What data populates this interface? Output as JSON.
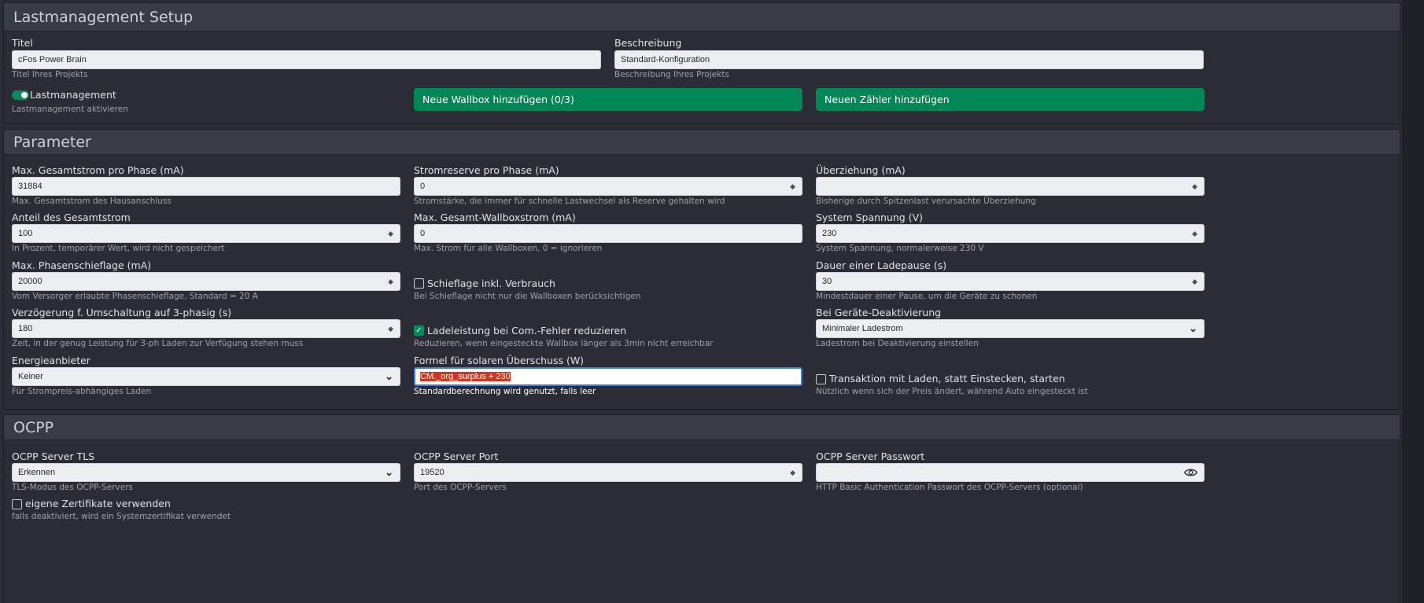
{
  "setup": {
    "title": "Lastmanagement Setup",
    "titel_label": "Titel",
    "titel_value": "cFos Power Brain",
    "titel_help": "Titel Ihres Projekts",
    "beschreibung_label": "Beschreibung",
    "beschreibung_value": "Standard-Konfiguration",
    "beschreibung_help": "Beschreibung Ihres Projekts",
    "lastmanagement_label": "Lastmanagement",
    "lastmanagement_help": "Lastmanagement aktivieren",
    "lastmanagement_enabled": true,
    "add_wallbox_button": "Neue Wallbox hinzufügen (0/3)",
    "add_meter_button": "Neuen Zähler hinzufügen"
  },
  "parameter": {
    "title": "Parameter",
    "fields": {
      "max_gesamtstrom": {
        "label": "Max. Gesamtstrom pro Phase (mA)",
        "value": "31884",
        "help": "Max. Gesamtstrom des Hausanschluss"
      },
      "stromreserve": {
        "label": "Stromreserve pro Phase (mA)",
        "value": "0",
        "help": "Stromstärke, die immer für schnelle Lastwechsel als Reserve gehalten wird"
      },
      "ueberziehung": {
        "label": "Überziehung (mA)",
        "value": "",
        "help": "Bisherige durch Spitzenlast verursachte Überziehung"
      },
      "anteil": {
        "label": "Anteil des Gesamtstrom",
        "value": "100",
        "help": "In Prozent, temporärer Wert, wird nicht gespeichert"
      },
      "max_wallboxstrom": {
        "label": "Max. Gesamt-Wallboxstrom (mA)",
        "value": "0",
        "help": "Max. Strom für alle Wallboxen, 0 = ignorieren"
      },
      "system_spannung": {
        "label": "System Spannung (V)",
        "value": "230",
        "help": "System Spannung, normalerweise 230 V"
      },
      "phasenschieflage": {
        "label": "Max. Phasenschieflage (mA)",
        "value": "20000",
        "help": "Vom Versorger erlaubte Phasenschieflage, Standard = 20 A"
      },
      "schieflage_verbrauch": {
        "label": "Schieflage inkl. Verbrauch",
        "checked": false,
        "help": "Bei Schieflage nicht nur die Wallboxen berücksichtigen"
      },
      "ladepause": {
        "label": "Dauer einer Ladepause (s)",
        "value": "30",
        "help": "Mindestdauer einer Pause, um die Geräte zu schonen"
      },
      "verzoegerung": {
        "label": "Verzögerung f. Umschaltung auf 3-phasig (s)",
        "value": "180",
        "help": "Zeit, in der genug Leistung für 3-ph Laden zur Verfügung stehen muss"
      },
      "ladeleistung_fehler": {
        "label": "Ladeleistung bei Com.-Fehler reduzieren",
        "checked": true,
        "help": "Reduzieren, wenn eingesteckte Wallbox länger als 3min nicht erreichbar"
      },
      "geraete_deaktivierung": {
        "label": "Bei Geräte-Deaktivierung",
        "value": "Minimaler Ladestrom",
        "help": "Ladestrom bei Deaktivierung einstellen"
      },
      "energieanbieter": {
        "label": "Energieanbieter",
        "value": "Keiner",
        "help": "Für Strompreis-abhängiges Laden"
      },
      "formel": {
        "label": "Formel für solaren Überschuss (W)",
        "value": "CM._org_surplus + 230",
        "help": "Standardberechnung wird genutzt, falls leer"
      },
      "transaktion": {
        "label": "Transaktion mit Laden, statt Einstecken, starten",
        "checked": false,
        "help": "Nützlich wenn sich der Preis ändert, während Auto eingesteckt ist"
      }
    }
  },
  "ocpp": {
    "title": "OCPP",
    "tls": {
      "label": "OCPP Server TLS",
      "value": "Erkennen",
      "help": "TLS-Modus des OCPP-Servers"
    },
    "port": {
      "label": "OCPP Server Port",
      "value": "19520",
      "help": "Port des OCPP-Servers"
    },
    "passwort": {
      "label": "OCPP Server Passwort",
      "value": "",
      "help": "HTTP Basic Authentication Passwort des OCPP-Servers (optional)"
    },
    "zertifikate": {
      "label": "eigene Zertifikate verwenden",
      "checked": false,
      "help": "falls deaktiviert, wird ein Systemzertifikat verwendet"
    }
  },
  "icons": {
    "spin": "spin-updown-icon",
    "select": "chevron-down-icon",
    "check": "checkmark-icon",
    "password": "eye-icon"
  },
  "colors": {
    "button": "#018856",
    "toggle": "#0b8a5a",
    "highlight": "#d3351f",
    "focus": "#3d7bd9"
  }
}
